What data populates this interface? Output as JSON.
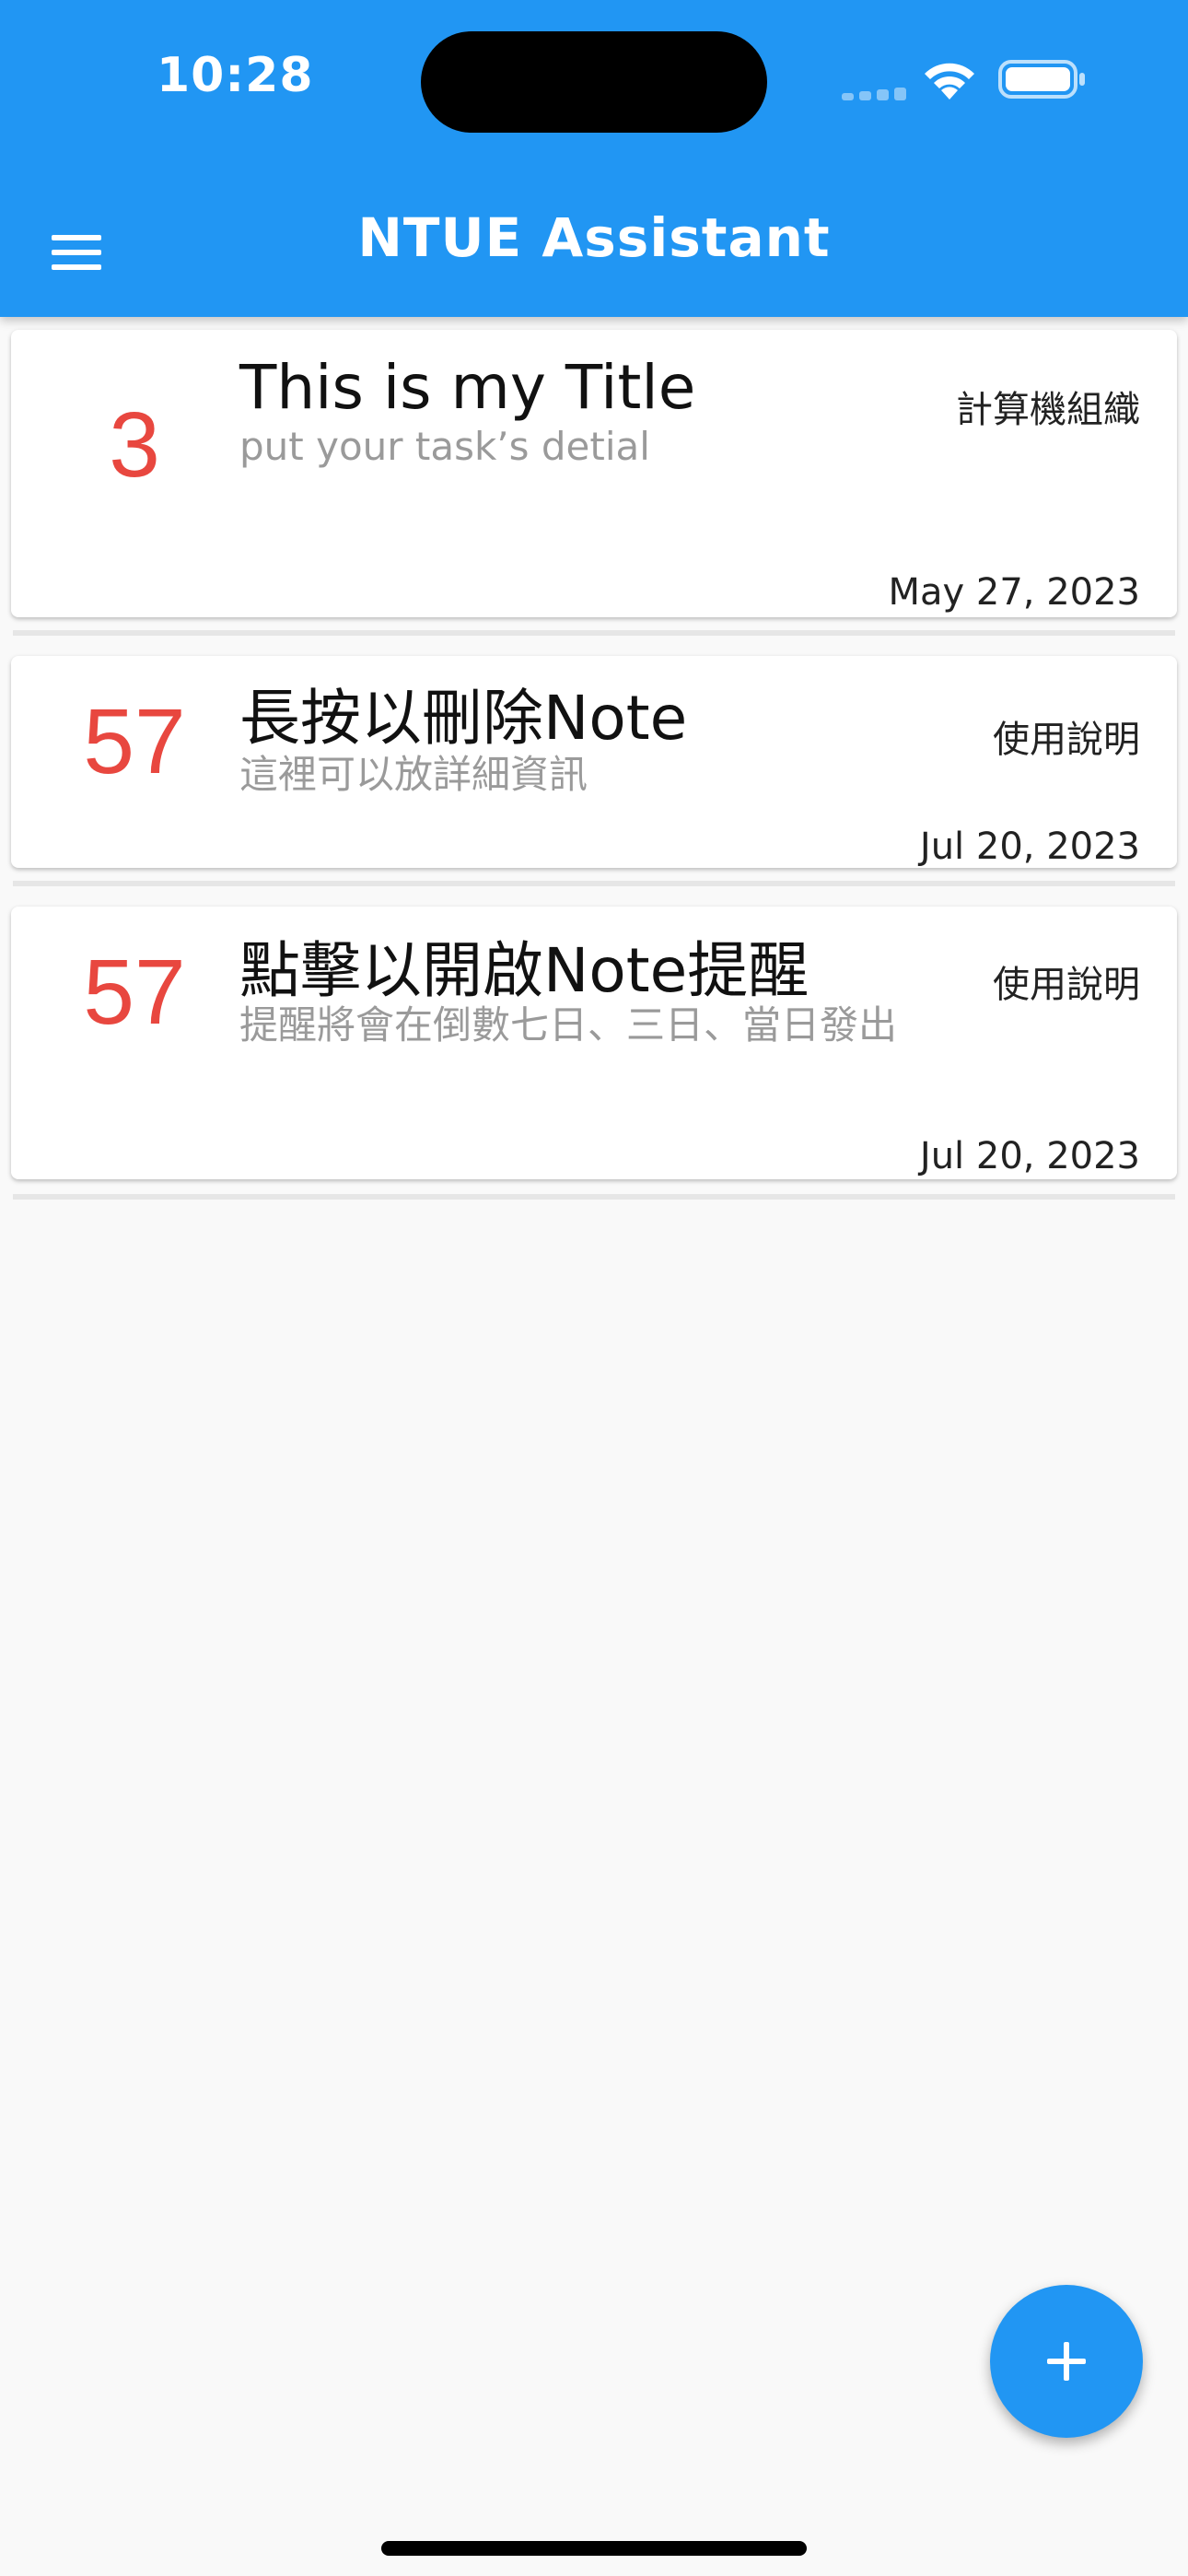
{
  "status_bar": {
    "time": "10:28"
  },
  "app_bar": {
    "title": "NTUE Assistant"
  },
  "notes": [
    {
      "days_left": "3",
      "title": "This is my Title",
      "detail": "put your task’s detial",
      "category": "計算機組織",
      "date": "May 27, 2023"
    },
    {
      "days_left": "57",
      "title": "長按以刪除Note",
      "detail": "這裡可以放詳細資訊",
      "category": "使用說明",
      "date": "Jul 20, 2023"
    },
    {
      "days_left": "57",
      "title": "點擊以開啟Note提醒",
      "detail": "提醒將會在倒數七日、三日、當日發出",
      "category": "使用說明",
      "date": "Jul 20, 2023"
    }
  ],
  "colors": {
    "primary": "#2196f3",
    "countdown": "#e8473f",
    "background": "#f9f9f9"
  },
  "icons": {
    "menu": "menu-icon",
    "add": "add-icon",
    "wifi": "wifi-icon",
    "battery": "battery-icon"
  }
}
